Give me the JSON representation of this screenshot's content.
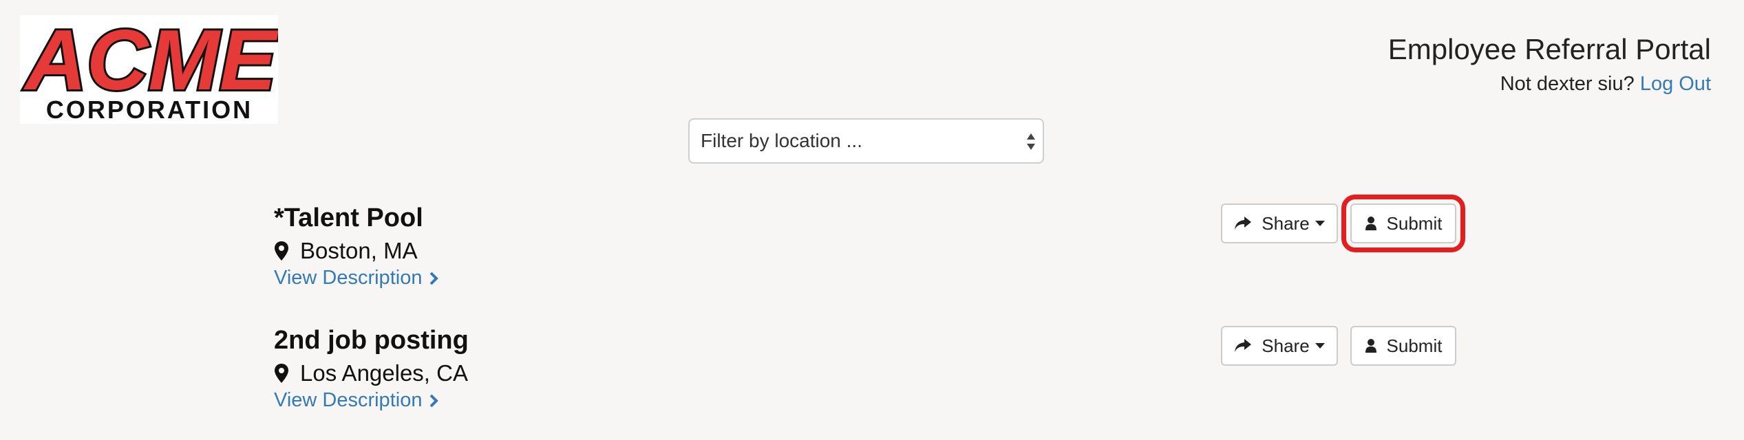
{
  "logo": {
    "line1": "ACME",
    "line2": "CORPORATION"
  },
  "header": {
    "title": "Employee Referral Portal",
    "user_prefix": "Not dexter siu?",
    "logout_label": "Log Out"
  },
  "filter": {
    "placeholder": "Filter by location ..."
  },
  "jobs": [
    {
      "title": "*Talent Pool",
      "location": "Boston, MA",
      "view_label": "View Description",
      "share_label": "Share",
      "submit_label": "Submit",
      "submit_highlighted": true
    },
    {
      "title": "2nd job posting",
      "location": "Los Angeles, CA",
      "view_label": "View Description",
      "share_label": "Share",
      "submit_label": "Submit",
      "submit_highlighted": false
    }
  ],
  "colors": {
    "link": "#337ab7",
    "logo_red": "#e53a37",
    "highlight": "#e31e1e"
  }
}
